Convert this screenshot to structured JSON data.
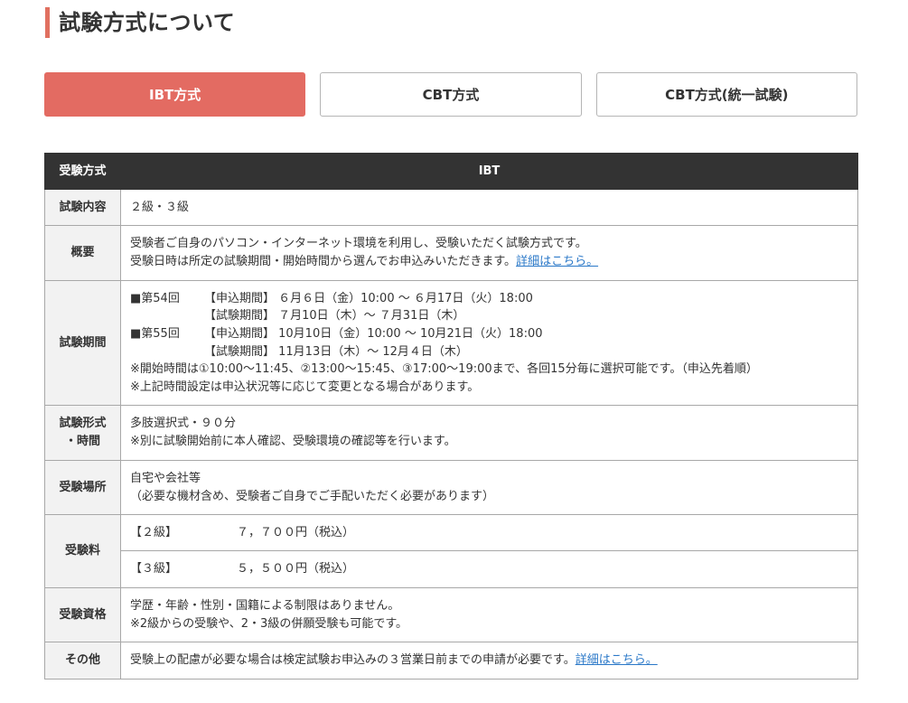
{
  "page_title": "試験方式について",
  "tabs": [
    {
      "label": "IBT方式",
      "active": true
    },
    {
      "label": "CBT方式",
      "active": false
    },
    {
      "label": "CBT方式(統一試験)",
      "active": false
    }
  ],
  "accent_color": "#e36b62",
  "table": {
    "header": {
      "label": "受験方式",
      "value": "IBT"
    },
    "content": {
      "label": "試験内容",
      "value": "２級・３級"
    },
    "overview": {
      "label": "概要",
      "line1": "受験者ご自身のパソコン・インターネット環境を利用し、受験いただく試験方式です。",
      "line2": "受験日時は所定の試験期間・開始時間から選んでお申込みいただきます。",
      "link": "詳細はこちら。"
    },
    "period": {
      "label": "試験期間",
      "rounds": [
        {
          "name": "■第54回",
          "apply": "【申込期間】 ６月６日（金）10:00 ～ ６月17日（火）18:00",
          "exam": "【試験期間】 ７月10日（木）～ ７月31日（木）"
        },
        {
          "name": "■第55回",
          "apply": "【申込期間】 10月10日（金）10:00 ～ 10月21日（火）18:00",
          "exam": "【試験期間】 11月13日（木）～ 12月４日（木）"
        }
      ],
      "note1": "※開始時間は①10:00～11:45、②13:00～15:45、③17:00～19:00まで、各回15分毎に選択可能です。（申込先着順）",
      "note2": "※上記時間設定は申込状況等に応じて変更となる場合があります。"
    },
    "format": {
      "label_line1": "試験形式",
      "label_line2": "・時間",
      "line1": "多肢選択式・９０分",
      "line2": "※別に試験開始前に本人確認、受験環境の確認等を行います。"
    },
    "venue": {
      "label": "受験場所",
      "line1": "自宅や会社等",
      "line2": "（必要な機材含め、受験者ご自身でご手配いただく必要があります）"
    },
    "fee": {
      "label": "受験料",
      "rows": [
        {
          "grade": "【２級】",
          "amount": "７，７００円（税込）"
        },
        {
          "grade": "【３級】",
          "amount": "５，５００円（税込）"
        }
      ]
    },
    "eligibility": {
      "label": "受験資格",
      "line1": "学歴・年齢・性別・国籍による制限はありません。",
      "line2": "※2級からの受験や、2・3級の併願受験も可能です。"
    },
    "other": {
      "label": "その他",
      "text": "受験上の配慮が必要な場合は検定試験お申込みの３営業日前までの申請が必要です。",
      "link": "詳細はこちら。"
    }
  }
}
